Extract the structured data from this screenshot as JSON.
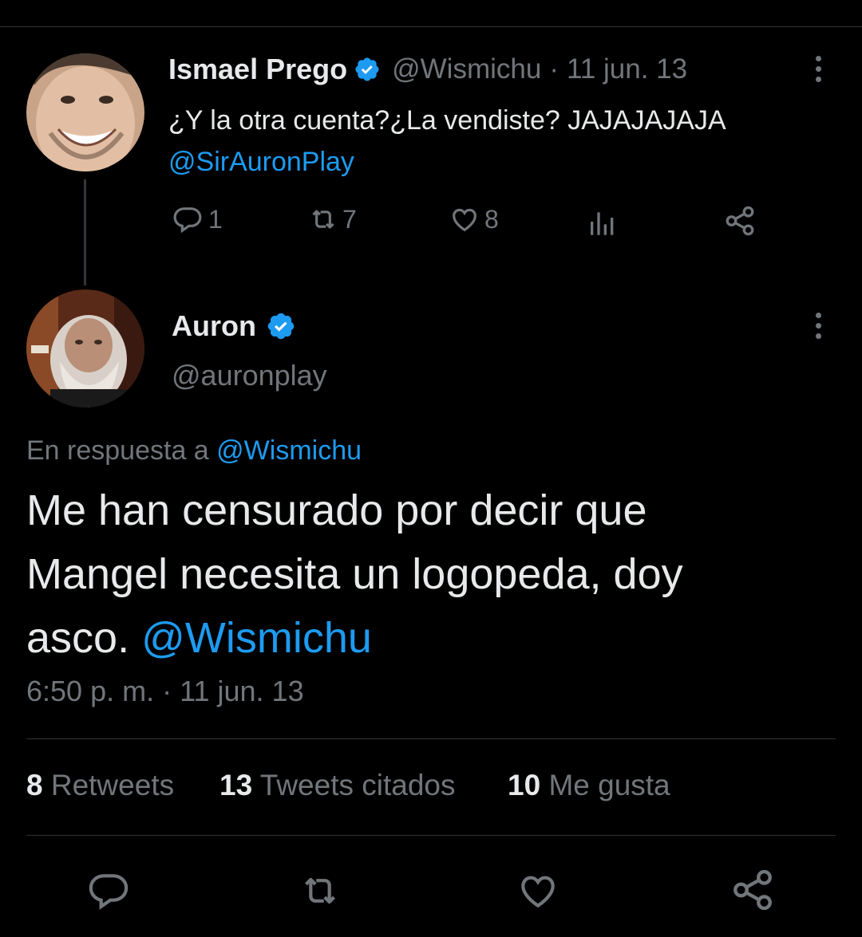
{
  "parent_tweet": {
    "display_name": "Ismael Prego",
    "handle": "@Wismichu",
    "separator": "·",
    "date": "11 jun. 13",
    "text": "¿Y la otra cuenta?¿La vendiste? JAJAJAJAJA",
    "mention": "@SirAuronPlay",
    "actions": {
      "replies": "1",
      "retweets": "7",
      "likes": "8"
    },
    "verified_icon": "verified-badge-icon"
  },
  "main_tweet": {
    "display_name": "Auron",
    "handle": "@auronplay",
    "reply_prefix": "En respuesta a",
    "reply_to": "@Wismichu",
    "text_line1": "Me han censurado por decir que",
    "text_line2": "Mangel necesita un logopeda, doy",
    "text_line3": "asco.",
    "mention": "@Wismichu",
    "time": "6:50 p. m.",
    "separator": "·",
    "date": "11 jun. 13",
    "verified_icon": "verified-badge-icon"
  },
  "stats": {
    "retweets_count": "8",
    "retweets_label": "Retweets",
    "quotes_count": "13",
    "quotes_label": "Tweets citados",
    "likes_count": "10",
    "likes_label": "Me gusta"
  },
  "colors": {
    "background": "#000000",
    "text": "#e7e9ea",
    "muted": "#71767b",
    "link": "#1d9bf0",
    "divider": "#2f3336"
  }
}
